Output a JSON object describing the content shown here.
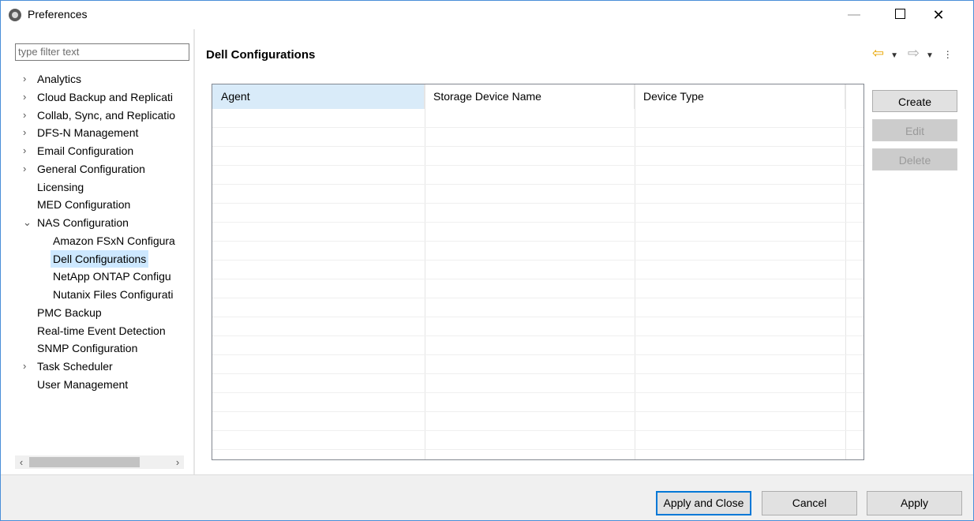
{
  "window": {
    "title": "Preferences",
    "min_glyph": "—",
    "close_glyph": "✕"
  },
  "sidebar": {
    "filter_placeholder": "type filter text",
    "items": [
      {
        "label": "Analytics",
        "expandable": true
      },
      {
        "label": "Cloud Backup and Replicati",
        "expandable": true
      },
      {
        "label": "Collab, Sync, and Replicatio",
        "expandable": true
      },
      {
        "label": "DFS-N Management",
        "expandable": true
      },
      {
        "label": "Email Configuration",
        "expandable": true
      },
      {
        "label": "General Configuration",
        "expandable": true
      },
      {
        "label": "Licensing"
      },
      {
        "label": "MED Configuration"
      },
      {
        "label": "NAS Configuration",
        "expanded": true
      },
      {
        "label": "Amazon FSxN Configura"
      },
      {
        "label": "Dell Configurations",
        "selected": true
      },
      {
        "label": "NetApp ONTAP Configu"
      },
      {
        "label": "Nutanix Files Configurati"
      },
      {
        "label": "PMC Backup"
      },
      {
        "label": "Real-time Event Detection"
      },
      {
        "label": "SNMP Configuration"
      },
      {
        "label": "Task Scheduler",
        "expandable": true
      },
      {
        "label": "User Management"
      }
    ]
  },
  "main": {
    "title": "Dell Configurations",
    "table": {
      "columns": [
        "Agent",
        "Storage Device Name",
        "Device Type"
      ],
      "rows": []
    },
    "buttons": {
      "create": "Create",
      "edit": "Edit",
      "delete": "Delete"
    }
  },
  "footer": {
    "apply_close": "Apply and Close",
    "cancel": "Cancel",
    "apply": "Apply"
  }
}
